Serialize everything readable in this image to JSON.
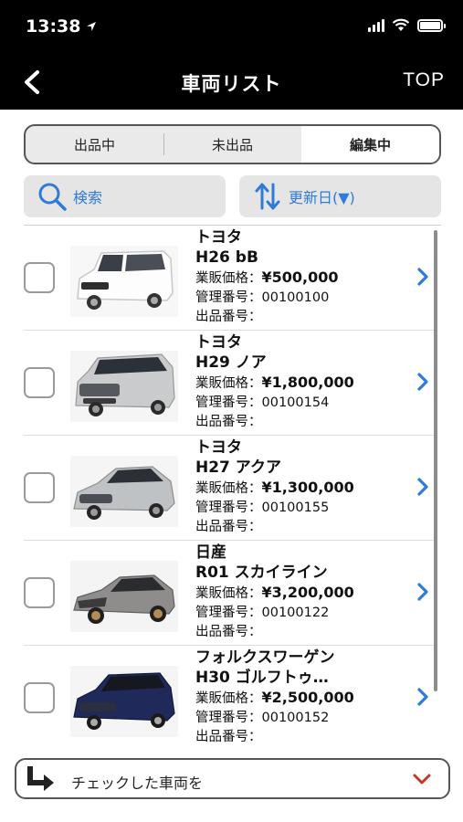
{
  "status_bar": {
    "time": "13:38"
  },
  "nav": {
    "title": "車両リスト",
    "top_link": "TOP"
  },
  "segments": [
    {
      "label": "出品中",
      "active": false
    },
    {
      "label": "未出品",
      "active": false
    },
    {
      "label": "編集中",
      "active": true
    }
  ],
  "search": {
    "label": "検索"
  },
  "sort": {
    "label": "更新日(▼)"
  },
  "vehicles": [
    {
      "maker": "トヨタ",
      "model": "H26 bB",
      "price_label": "業販価格：",
      "price": "¥500,000",
      "mgmt_label": "管理番号：",
      "mgmt_no": "00100100",
      "listing_label": "出品番号：",
      "listing_no": "",
      "checked": false,
      "image": "white-toyota-bb-photo"
    },
    {
      "maker": "トヨタ",
      "model": "H29 ノア",
      "price_label": "業販価格：",
      "price": "¥1,800,000",
      "mgmt_label": "管理番号：",
      "mgmt_no": "00100154",
      "listing_label": "出品番号：",
      "listing_no": "",
      "checked": false,
      "image": "silver-toyota-noah-photo"
    },
    {
      "maker": "トヨタ",
      "model": "H27 アクア",
      "price_label": "業販価格：",
      "price": "¥1,300,000",
      "mgmt_label": "管理番号：",
      "mgmt_no": "00100155",
      "listing_label": "出品番号：",
      "listing_no": "",
      "checked": false,
      "image": "silver-toyota-aqua-photo"
    },
    {
      "maker": "日産",
      "model": "R01 スカイライン",
      "price_label": "業販価格：",
      "price": "¥3,200,000",
      "mgmt_label": "管理番号：",
      "mgmt_no": "00100122",
      "listing_label": "出品番号：",
      "listing_no": "",
      "checked": false,
      "image": "gray-nissan-skyline-photo"
    },
    {
      "maker": "フォルクスワーゲン",
      "model": "H30 ゴルフトゥ…",
      "price_label": "業販価格：",
      "price": "¥2,500,000",
      "mgmt_label": "管理番号：",
      "mgmt_no": "00100152",
      "listing_label": "出品番号：",
      "listing_no": "",
      "checked": false,
      "image": "navy-vw-golf-touran-photo"
    }
  ],
  "bulk_action": {
    "label": "チェックした車両を"
  },
  "colors": {
    "accent": "#2f7bd8",
    "header_bg": "#000000",
    "chevron_red": "#c0392b"
  }
}
